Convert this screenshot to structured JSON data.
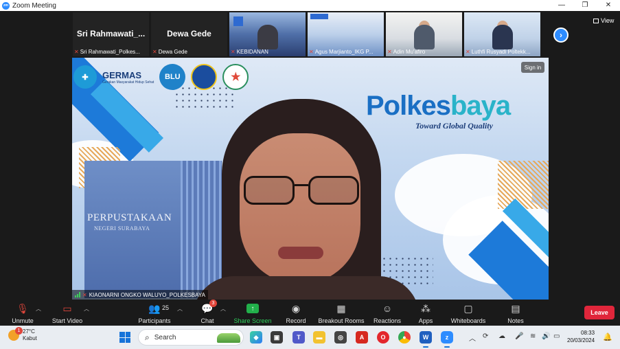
{
  "window": {
    "title": "Zoom Meeting",
    "app_logo_text": "zm",
    "controls": [
      "—",
      "❐",
      "✕"
    ]
  },
  "view_button": {
    "label": "View"
  },
  "strip": {
    "tiles": [
      {
        "big_name": "Sri  Rahmawati_...",
        "caption": "Sri Rahmawati_Polkes...",
        "video": false
      },
      {
        "big_name": "Dewa Gede",
        "caption": "Dewa Gede",
        "video": false
      },
      {
        "big_name": "",
        "caption": "KEBIDANAN",
        "video": true
      },
      {
        "big_name": "",
        "caption": "Agus Marjianto_IKG P...",
        "video": true
      },
      {
        "big_name": "",
        "caption": "Adin Mu'afiro",
        "video": true
      },
      {
        "big_name": "",
        "caption": "Luthfi Rusyadi Poltekk...",
        "video": true
      }
    ],
    "next_icon": "›"
  },
  "main_video": {
    "speaker_name": "KIAONARNI ONGKO WALUYO_POLKESBAYA",
    "sign_in_label": "Sign in",
    "background": {
      "logo_germas": "GERMAS",
      "logo_germas_sub": "Gerakan Masyarakat Hidup Sehat",
      "logo_blu": "BLU",
      "brand_main": "Polkes",
      "brand_accent": "baya",
      "tagline": "Toward Global Quality",
      "building_sign": "PERPUSTAKAAN",
      "building_subsign": "NEGERI SURABAYA"
    }
  },
  "toolbar": {
    "unmute": "Unmute",
    "start_video": "Start Video",
    "participants": "Participants",
    "participants_count": "25",
    "chat": "Chat",
    "chat_badge": "3",
    "share_screen": "Share Screen",
    "record": "Record",
    "breakout_rooms": "Breakout Rooms",
    "reactions": "Reactions",
    "apps": "Apps",
    "whiteboards": "Whiteboards",
    "notes": "Notes",
    "leave": "Leave"
  },
  "taskbar": {
    "weather_temp": "27°C",
    "weather_desc": "Kabut",
    "weather_badge": "1",
    "search_label": "Search",
    "time": "08:33",
    "date": "20/03/2024"
  },
  "colors": {
    "zoom_blue": "#2d8cff",
    "leave_red": "#e0263b",
    "share_green": "#22b04b",
    "brand_blue": "#1a6fc4"
  }
}
